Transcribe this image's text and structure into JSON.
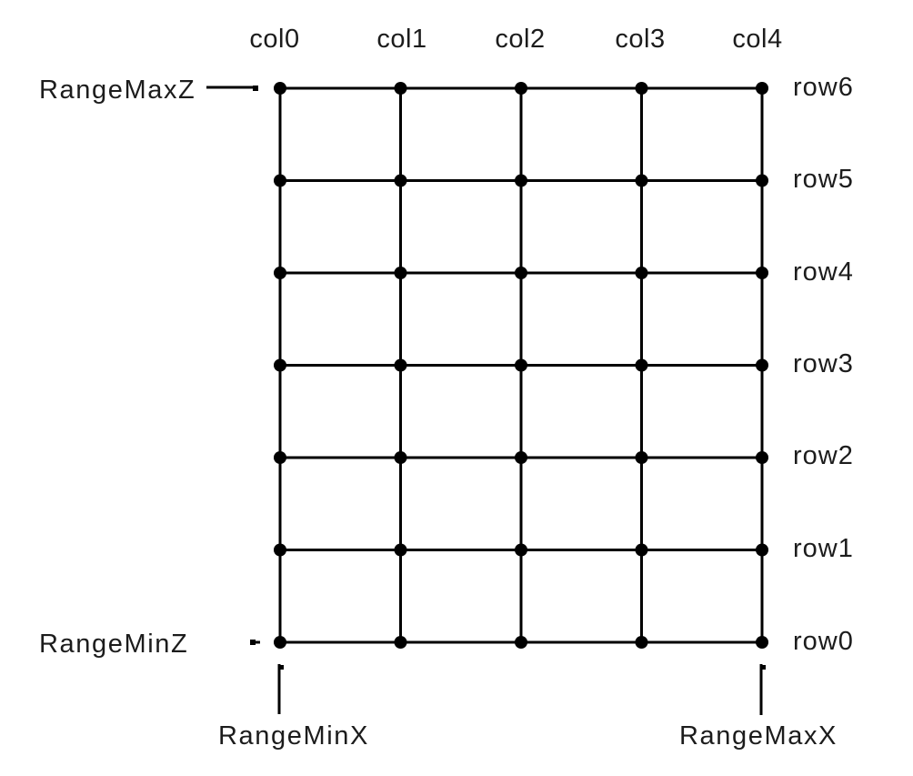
{
  "diagram": {
    "type": "grid-layout",
    "columns": [
      "col0",
      "col1",
      "col2",
      "col3",
      "col4"
    ],
    "rows": [
      "row0",
      "row1",
      "row2",
      "row3",
      "row4",
      "row5",
      "row6"
    ],
    "range_labels": {
      "max_z": "RangeMaxZ",
      "min_z": "RangeMinZ",
      "min_x": "RangeMinX",
      "max_x": "RangeMaxX"
    },
    "colors": {
      "line": "#000000",
      "node": "#000000",
      "text": "#1c1c1c",
      "background": "#ffffff"
    }
  }
}
